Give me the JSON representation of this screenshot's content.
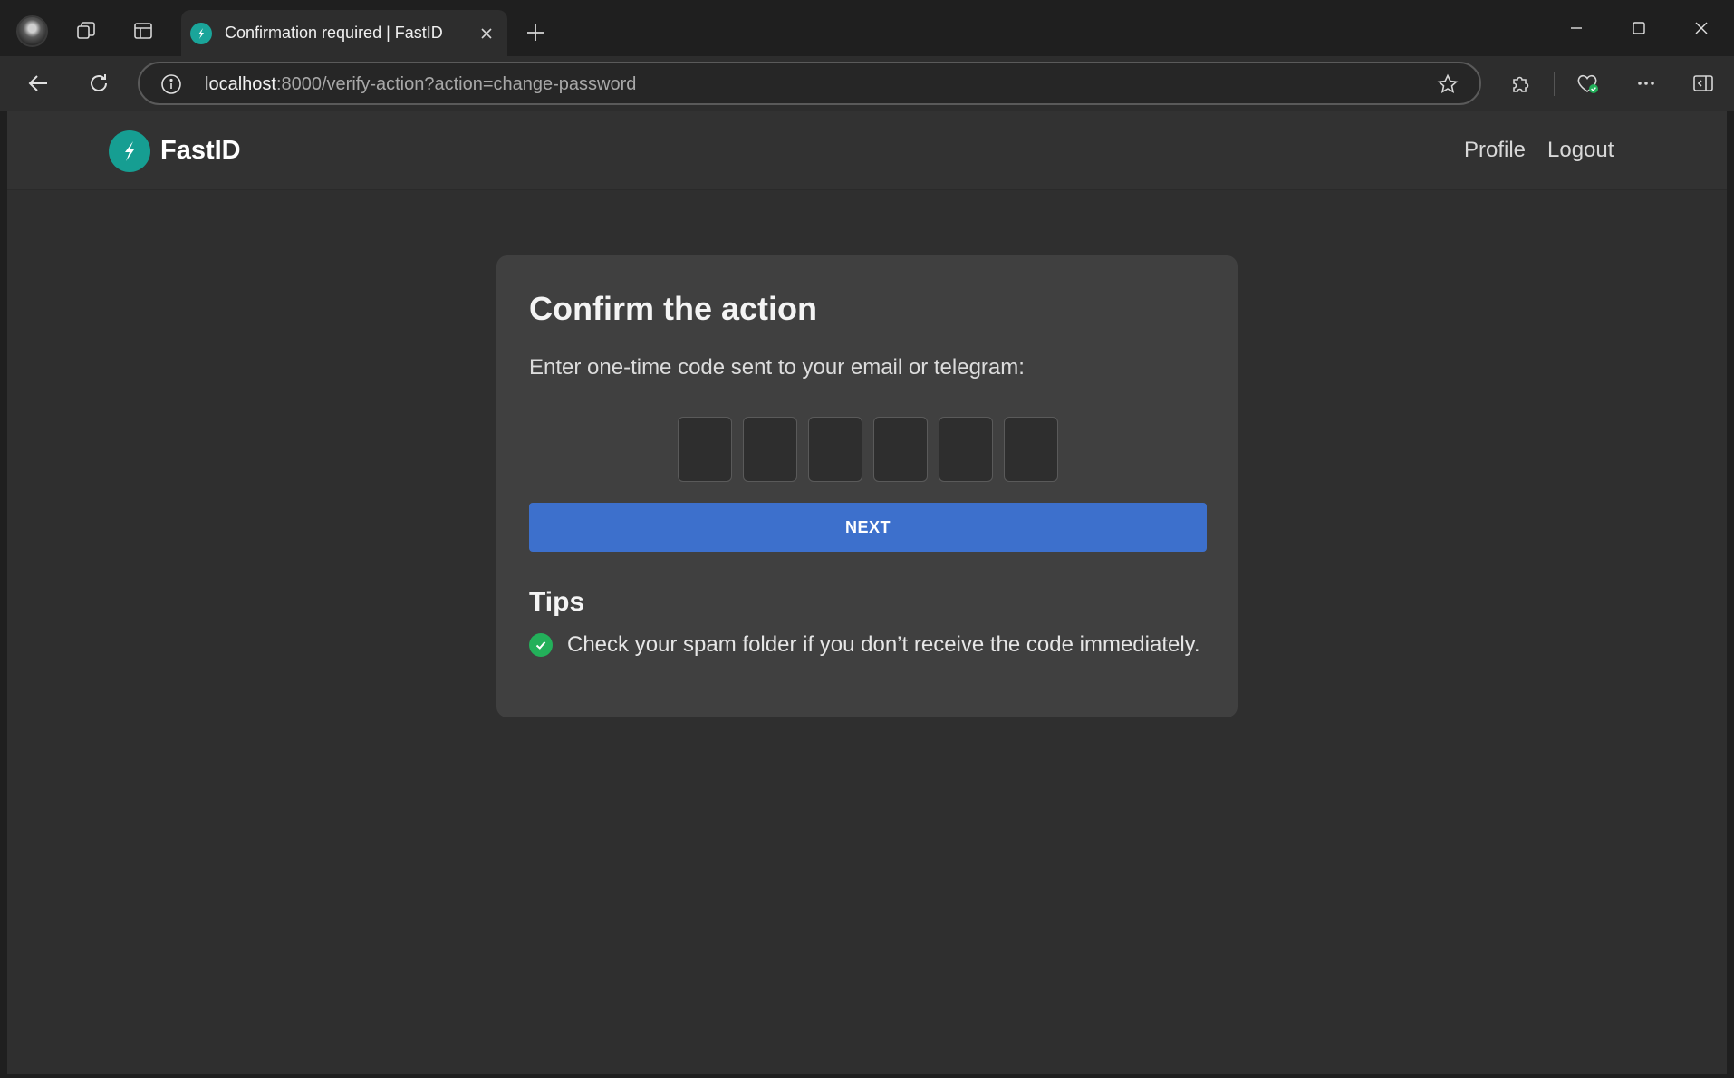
{
  "browser": {
    "tab_title": "Confirmation required | FastID",
    "url_host": "localhost",
    "url_rest": ":8000/verify-action?action=change-password",
    "accent_color": "#1aa59a"
  },
  "site": {
    "brand": "FastID",
    "nav": {
      "profile": "Profile",
      "logout": "Logout"
    }
  },
  "card": {
    "title": "Confirm the action",
    "subtitle": "Enter one-time code sent to your email or telegram:",
    "otp_digits": [
      "",
      "",
      "",
      "",
      "",
      ""
    ],
    "next_label": "NEXT",
    "button_color": "#3d70cc",
    "tips_title": "Tips",
    "tips": [
      "Check your spam folder if you don’t receive the code immediately."
    ],
    "tip_icon_color": "#23b05a"
  }
}
